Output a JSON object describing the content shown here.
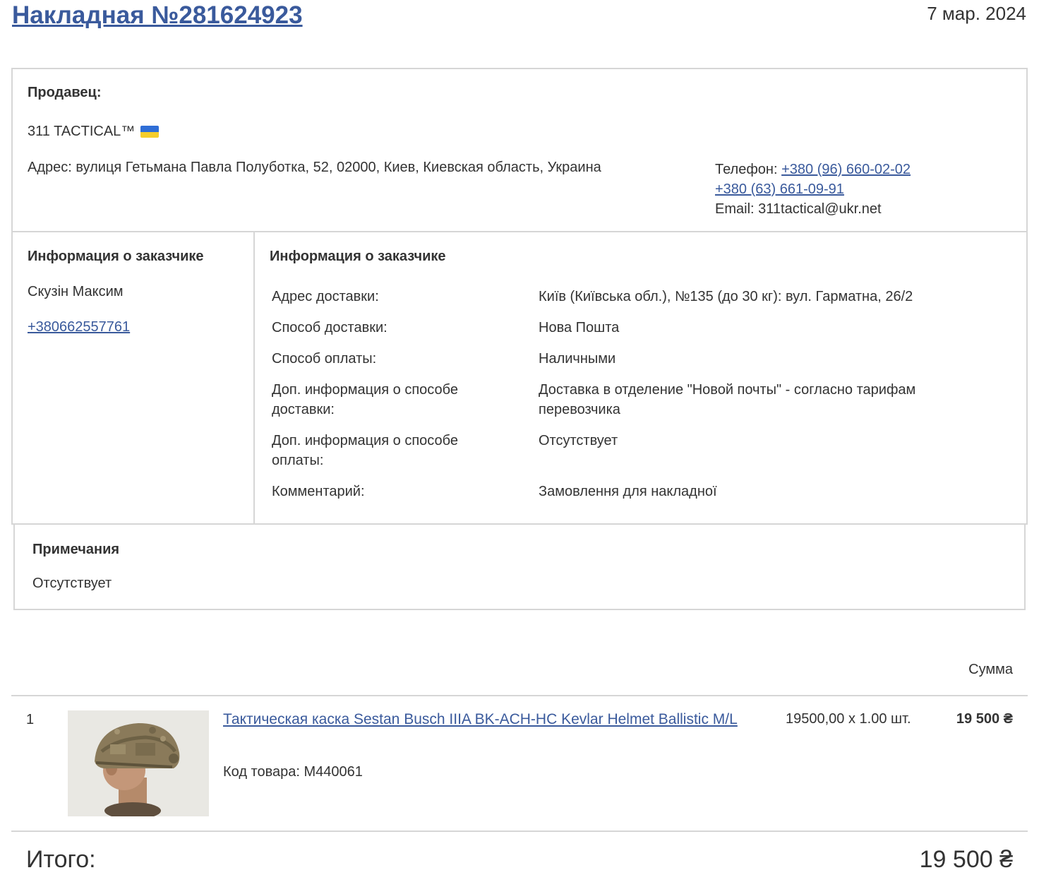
{
  "header": {
    "title": "Накладная №281624923",
    "date": "7 мар. 2024"
  },
  "seller": {
    "label": "Продавец:",
    "name": "311 TACTICAL™",
    "address": "Адрес: вулиця Гетьмана Павла Полуботка, 52, 02000, Киев, Киевская область, Украина",
    "phone_label": "Телефон: ",
    "phone1": "+380 (96) 660-02-02",
    "phone2": "+380 (63) 661-09-91",
    "email": "Email: 311tactical@ukr.net",
    "flag_colors": [
      "#2f6ed6",
      "#f5cd2b"
    ]
  },
  "customer": {
    "heading": "Информация о заказчике",
    "name": "Скузін Максим",
    "phone": "+380662557761"
  },
  "delivery": {
    "heading": "Информация о заказчике",
    "rows": [
      {
        "key": "Адрес доставки:",
        "value": "Київ (Київська обл.), №135 (до 30 кг): вул. Гарматна, 26/2"
      },
      {
        "key": "Способ доставки:",
        "value": "Нова Пошта"
      },
      {
        "key": "Способ оплаты:",
        "value": "Наличными"
      },
      {
        "key": "Доп. информация о способе доставки:",
        "value": "Доставка в отделение \"Новой почты\" - согласно тарифам перевозчика"
      },
      {
        "key": "Доп. информация о способе оплаты:",
        "value": "Отсутствует"
      },
      {
        "key": "Комментарий:",
        "value": "Замовлення для накладної"
      }
    ]
  },
  "notes": {
    "label": "Примечания",
    "text": "Отсутствует"
  },
  "items": {
    "sum_header": "Сумма",
    "list": [
      {
        "num": "1",
        "title": "Тактическая каска Sestan Busch IIIA BK-ACH-HC Kevlar Helmet Ballistic M/L",
        "code": "Код товара: M440061",
        "price": "19500,00 x 1.00 шт.",
        "sum": "19 500 ₴"
      }
    ]
  },
  "total": {
    "label": "Итого:",
    "value": "19 500 ₴"
  }
}
